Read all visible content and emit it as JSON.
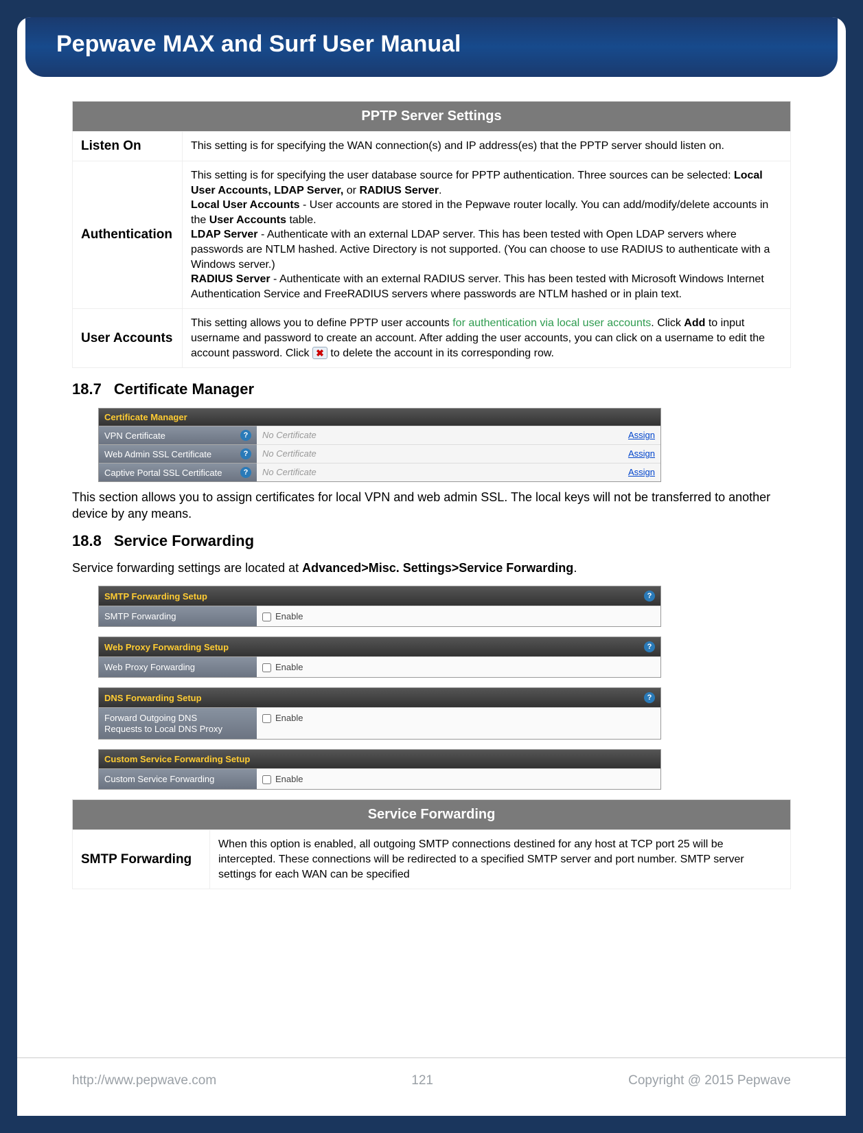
{
  "header": {
    "title": "Pepwave MAX and Surf User Manual"
  },
  "pptp_table": {
    "title": "PPTP Server Settings",
    "rows": [
      {
        "label": "Listen On",
        "desc": "This setting is for specifying the WAN connection(s) and IP address(es) that the PPTP server should listen on."
      },
      {
        "label": "Authentication",
        "intro": "This setting is for specifying the user database source for PPTP authentication. Three sources can be selected: ",
        "bold1": "Local User Accounts, LDAP Server,",
        "mid1": " or ",
        "bold2": "RADIUS Server",
        "period": ".",
        "local_b": "Local User Accounts",
        "local_t": " - User accounts are stored in the Pepwave router locally. You can add/modify/delete accounts in the ",
        "local_b2": "User Accounts",
        "local_t2": " table.",
        "ldap_b": "LDAP Server",
        "ldap_t": " - Authenticate with an external LDAP server. This has been tested with Open LDAP servers where passwords are NTLM hashed. Active Directory is not supported. (You can choose to use RADIUS to authenticate with a Windows server.)",
        "radius_b": "RADIUS Server",
        "radius_t": " - Authenticate with an external RADIUS server. This has been tested with Microsoft Windows Internet Authentication Service and FreeRADIUS servers where passwords are NTLM hashed or in plain text."
      },
      {
        "label": "User Accounts",
        "t1": "This setting allows you to define PPTP user accounts ",
        "green": "for authentication via local user accounts",
        "t2": ". Click ",
        "b1": "Add",
        "t3": " to input username and password to create an account. After adding the user accounts, you can click on a username to edit the account password. Click ",
        "t4": " to delete the account in its corresponding row."
      }
    ]
  },
  "section187": {
    "num": "18.7",
    "title": "Certificate Manager"
  },
  "cert": {
    "header": "Certificate Manager",
    "rows": [
      {
        "label": "VPN Certificate",
        "value": "No Certificate",
        "action": "Assign"
      },
      {
        "label": "Web Admin SSL Certificate",
        "value": "No Certificate",
        "action": "Assign"
      },
      {
        "label": "Captive Portal SSL Certificate",
        "value": "No Certificate",
        "action": "Assign"
      }
    ]
  },
  "cert_desc": "This section allows you to assign certificates for local VPN and web admin SSL. The local keys will not be transferred to another device by any means.",
  "section188": {
    "num": "18.8",
    "title": "Service Forwarding"
  },
  "svc_intro_a": "Service forwarding settings are located at ",
  "svc_intro_b": "Advanced>Misc. Settings>Service Forwarding",
  "svc_intro_c": ".",
  "svc": {
    "groups": [
      {
        "header": "SMTP Forwarding Setup",
        "label": "SMTP Forwarding",
        "enable": "Enable"
      },
      {
        "header": "Web Proxy Forwarding Setup",
        "label": "Web Proxy Forwarding",
        "enable": "Enable"
      },
      {
        "header": "DNS Forwarding Setup",
        "label1": "Forward Outgoing DNS",
        "label2": "Requests to Local DNS Proxy",
        "enable": "Enable"
      },
      {
        "header": "Custom Service Forwarding Setup",
        "label": "Custom Service Forwarding",
        "enable": "Enable"
      }
    ]
  },
  "sf_table": {
    "title": "Service Forwarding",
    "row": {
      "label": "SMTP Forwarding",
      "desc": "When this option is enabled, all outgoing SMTP connections destined for any host at TCP port 25 will be intercepted. These connections will be redirected to a specified SMTP server and port number. SMTP server settings for each WAN can be specified"
    }
  },
  "footer": {
    "url": "http://www.pepwave.com",
    "page": "121",
    "copyright": "Copyright @ 2015 Pepwave"
  }
}
